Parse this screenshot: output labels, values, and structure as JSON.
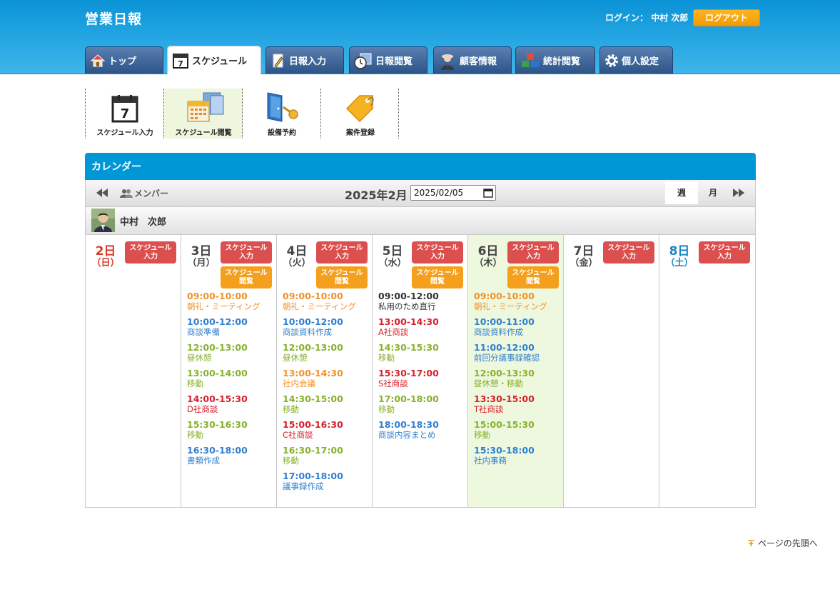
{
  "app": {
    "title": "営業日報"
  },
  "header": {
    "login_label": "ログイン：",
    "user_name": "中村 次郎",
    "logout_label": "ログアウト"
  },
  "tabs": [
    {
      "label": "トップ",
      "icon": "home-icon"
    },
    {
      "label": "スケジュール",
      "icon": "calendar-icon",
      "active": true
    },
    {
      "label": "日報入力",
      "icon": "pencil-icon"
    },
    {
      "label": "日報閲覧",
      "icon": "clock-icon"
    },
    {
      "label": "顧客情報",
      "icon": "customer-icon"
    },
    {
      "label": "統計閲覧",
      "icon": "blocks-icon"
    },
    {
      "label": "個人設定",
      "icon": "gear-icon"
    }
  ],
  "subnav": [
    {
      "label": "スケジュール入力",
      "icon": "calendar-7-icon"
    },
    {
      "label": "スケジュール閲覧",
      "icon": "calendar-browse-icon",
      "active": true
    },
    {
      "label": "設備予約",
      "icon": "door-key-icon"
    },
    {
      "label": "案件登録",
      "icon": "tag-icon"
    }
  ],
  "calendar": {
    "title": "カレンダー",
    "member_label": "メンバー",
    "month_label": "2025年2月",
    "date_value": "2025/02/05",
    "week_label": "週",
    "month_view_label": "月",
    "member_name": "中村　次郎"
  },
  "colors": {
    "orange": "#f0922b",
    "blue": "#2f7fd0",
    "green": "#86b22c",
    "red": "#d6212c",
    "dark": "#333333",
    "today_bg": "#eef8de"
  },
  "days": [
    {
      "num": "2日",
      "wd": "（日）",
      "kind": "sun",
      "btn_in": [
        "スケジュール",
        "入力"
      ],
      "events": []
    },
    {
      "num": "3日",
      "wd": "（月）",
      "btn_in": [
        "スケジュール",
        "入力"
      ],
      "btn_view": [
        "スケジュール",
        "閲覧"
      ],
      "events": [
        {
          "time": "09:00-10:00",
          "title": "朝礼・ミーティング",
          "color": "orange"
        },
        {
          "time": "10:00-12:00",
          "title": "商談準備",
          "color": "blue"
        },
        {
          "time": "12:00-13:00",
          "title": "昼休憩",
          "color": "green"
        },
        {
          "time": "13:00-14:00",
          "title": "移動",
          "color": "green"
        },
        {
          "time": "14:00-15:30",
          "title": "D社商談",
          "color": "red"
        },
        {
          "time": "15:30-16:30",
          "title": "移動",
          "color": "green"
        },
        {
          "time": "16:30-18:00",
          "title": "書類作成",
          "color": "blue"
        }
      ]
    },
    {
      "num": "4日",
      "wd": "（火）",
      "btn_in": [
        "スケジュール",
        "入力"
      ],
      "btn_view": [
        "スケジュール",
        "閲覧"
      ],
      "events": [
        {
          "time": "09:00-10:00",
          "title": "朝礼・ミーティング",
          "color": "orange"
        },
        {
          "time": "10:00-12:00",
          "title": "商談資料作成",
          "color": "blue"
        },
        {
          "time": "12:00-13:00",
          "title": "昼休憩",
          "color": "green"
        },
        {
          "time": "13:00-14:30",
          "title": "社内会議",
          "color": "orange"
        },
        {
          "time": "14:30-15:00",
          "title": "移動",
          "color": "green"
        },
        {
          "time": "15:00-16:30",
          "title": "C社商談",
          "color": "red"
        },
        {
          "time": "16:30-17:00",
          "title": "移動",
          "color": "green"
        },
        {
          "time": "17:00-18:00",
          "title": "議事録作成",
          "color": "blue"
        }
      ]
    },
    {
      "num": "5日",
      "wd": "（水）",
      "btn_in": [
        "スケジュール",
        "入力"
      ],
      "btn_view": [
        "スケジュール",
        "閲覧"
      ],
      "events": [
        {
          "time": "09:00-12:00",
          "title": "私用のため直行",
          "color": "dark"
        },
        {
          "time": "13:00-14:30",
          "title": "A社商談",
          "color": "red"
        },
        {
          "time": "14:30-15:30",
          "title": "移動",
          "color": "green"
        },
        {
          "time": "15:30-17:00",
          "title": "S社商談",
          "color": "red"
        },
        {
          "time": "17:00-18:00",
          "title": "移動",
          "color": "green"
        },
        {
          "time": "18:00-18:30",
          "title": "商談内容まとめ",
          "color": "blue"
        }
      ]
    },
    {
      "num": "6日",
      "wd": "（木）",
      "today": true,
      "btn_in": [
        "スケジュール",
        "入力"
      ],
      "btn_view": [
        "スケジュール",
        "閲覧"
      ],
      "events": [
        {
          "time": "09:00-10:00",
          "title": "朝礼・ミーティング",
          "color": "orange"
        },
        {
          "time": "10:00-11:00",
          "title": "商談資料作成",
          "color": "blue"
        },
        {
          "time": "11:00-12:00",
          "title": "前回分議事録確認",
          "color": "blue"
        },
        {
          "time": "12:00-13:30",
          "title": "昼休憩・移動",
          "color": "green"
        },
        {
          "time": "13:30-15:00",
          "title": "T社商談",
          "color": "red"
        },
        {
          "time": "15:00-15:30",
          "title": "移動",
          "color": "green"
        },
        {
          "time": "15:30-18:00",
          "title": "社内事務",
          "color": "blue"
        }
      ]
    },
    {
      "num": "7日",
      "wd": "（金）",
      "btn_in": [
        "スケジュール",
        "入力"
      ],
      "events": []
    },
    {
      "num": "8日",
      "wd": "（土）",
      "kind": "sat",
      "btn_in": [
        "スケジュール",
        "入力"
      ],
      "events": []
    }
  ],
  "footer": {
    "back_to_top": "ページの先頭へ"
  }
}
